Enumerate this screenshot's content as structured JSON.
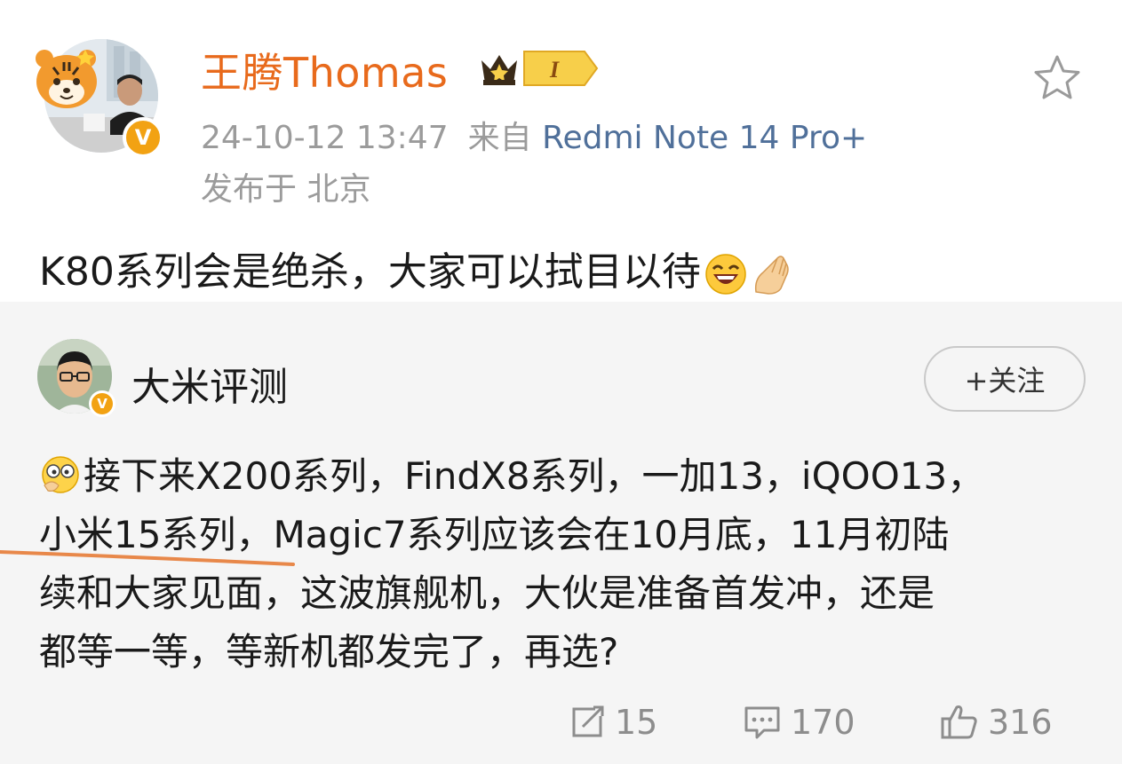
{
  "post": {
    "author": "王腾Thomas",
    "vip_level": "I",
    "date_time": "24-10-12 13:47",
    "source_prefix": "来自",
    "source_device": "Redmi Note 14 Pro+",
    "location": "发布于 北京",
    "text": "K80系列会是绝杀，大家可以拭目以待",
    "emojis": [
      "laughing-emoji",
      "pinched-fingers-emoji"
    ]
  },
  "repost": {
    "author": "大米评测",
    "follow_label": "+关注",
    "lines": [
      "接下来X200系列，FindX8系列，一加13，iQOO13，",
      "小米15系列，Magic7系列应该会在10月底，11月初陆",
      "续和大家见面，这波旗舰机，大伙是准备首发冲，还是",
      "都等一等，等新机都发完了，再选?"
    ],
    "leading_emoji": "thinking-emoji",
    "underline_color": "#e8884a"
  },
  "actions": {
    "reposts": "15",
    "comments": "170",
    "likes": "316"
  },
  "colors": {
    "author_name": "#e86a1c",
    "meta_gray": "#9b9b9b",
    "source_link": "#50709a",
    "repost_bg": "#f5f5f5",
    "verified_badge": "#f2a213"
  }
}
